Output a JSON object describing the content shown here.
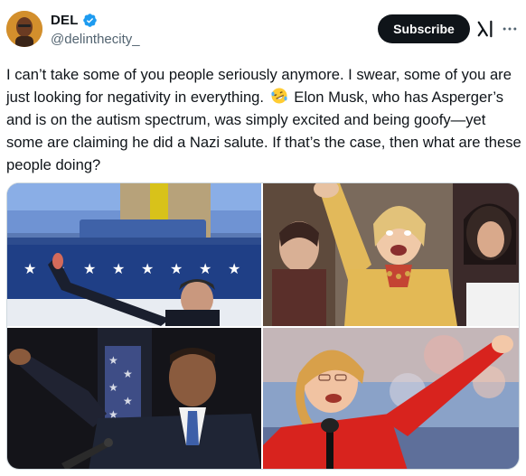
{
  "author": {
    "display_name": "DEL",
    "handle": "@delinthecity_",
    "verified": true,
    "avatar_icon": "avatar-portrait"
  },
  "actions": {
    "subscribe_label": "Subscribe",
    "grok_icon": "grok-icon",
    "more_icon": "more-options-icon"
  },
  "post": {
    "text_before_emoji": "I can’t take some of you people seriously anymore. I swear, some of you are just looking for negativity in everything.",
    "emoji": "rolling-on-floor-laughing-emoji",
    "text_after_emoji": "Elon Musk, who has Asperger’s and is on the autism spectrum, was simply excited and being goofy—yet some are claiming he did a Nazi salute. If that’s the case, then what are these people doing?"
  },
  "media": {
    "count": 4,
    "images": [
      {
        "name": "photo-man-arm-raised-stage"
      },
      {
        "name": "photo-woman-yellow-jacket-waving"
      },
      {
        "name": "photo-man-suit-arm-extended-flag"
      },
      {
        "name": "photo-woman-red-jacket-waving"
      }
    ]
  },
  "colors": {
    "text": "#0f1419",
    "secondary": "#536471",
    "verified_blue": "#1d9bf0",
    "button_bg": "#0f1419"
  }
}
